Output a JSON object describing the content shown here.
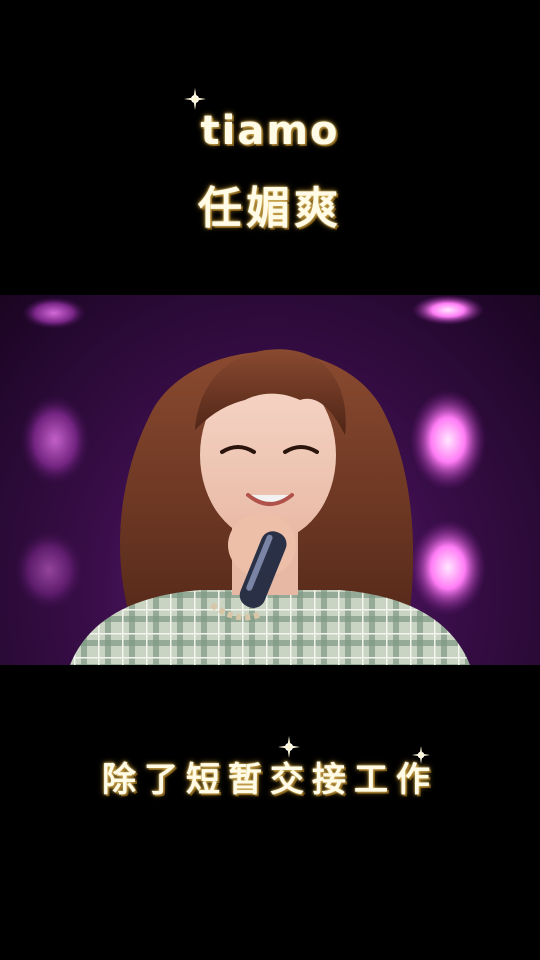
{
  "title": {
    "song": "tiamo",
    "artist": "任媚爽"
  },
  "lyrics": {
    "current_line": "除了短暂交接工作"
  },
  "colors": {
    "text": "#fffbe7",
    "glow": "#b98d2c",
    "stage_light": "#ff6cff",
    "background": "#000000"
  },
  "scene": {
    "icons": [
      "sparkle-icon",
      "microphone-icon"
    ]
  }
}
